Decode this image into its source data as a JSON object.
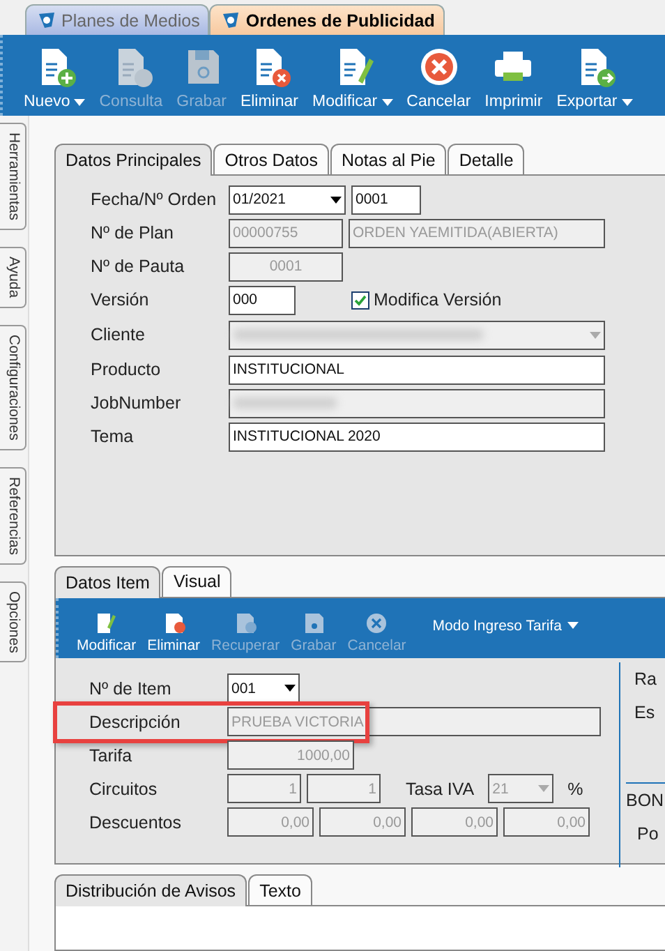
{
  "document_tabs": [
    {
      "label": "Planes de Medios",
      "selected": false
    },
    {
      "label": "Ordenes de Publicidad",
      "selected": true
    }
  ],
  "toolbar": [
    {
      "label": "Nuevo",
      "dropdown": true,
      "disabled": false
    },
    {
      "label": "Consulta",
      "dropdown": false,
      "disabled": true
    },
    {
      "label": "Grabar",
      "dropdown": false,
      "disabled": true
    },
    {
      "label": "Eliminar",
      "dropdown": false,
      "disabled": false
    },
    {
      "label": "Modificar",
      "dropdown": true,
      "disabled": false
    },
    {
      "label": "Cancelar",
      "dropdown": false,
      "disabled": false
    },
    {
      "label": "Imprimir",
      "dropdown": false,
      "disabled": false
    },
    {
      "label": "Exportar",
      "dropdown": true,
      "disabled": false
    }
  ],
  "side_tabs": [
    "Herramientas",
    "Ayuda",
    "Configuraciones",
    "Referencias",
    "Opciones"
  ],
  "main_tabs": [
    {
      "label": "Datos Principales",
      "selected": true
    },
    {
      "label": "Otros Datos",
      "selected": false
    },
    {
      "label": "Notas al Pie",
      "selected": false
    },
    {
      "label": "Detalle",
      "selected": false
    }
  ],
  "main_form": {
    "fecha_orden": {
      "label": "Fecha/Nº Orden",
      "period": {
        "value": "01/2021",
        "disabled": false
      },
      "number": {
        "value": "0001",
        "disabled": false
      }
    },
    "plan": {
      "label": "Nº de Plan",
      "number": {
        "value": "00000755",
        "disabled": true
      },
      "status": {
        "value": "ORDEN YAEMITIDA(ABIERTA)",
        "disabled": true
      }
    },
    "pauta": {
      "label": "Nº de Pauta",
      "value": "0001",
      "disabled": true
    },
    "version": {
      "label": "Versión",
      "value": "000",
      "disabled": false,
      "checkbox": {
        "label": "Modifica Versión",
        "checked": true
      }
    },
    "cliente": {
      "label": "Cliente",
      "disabled": true,
      "blurred": true
    },
    "producto": {
      "label": "Producto",
      "value": "INSTITUCIONAL",
      "disabled": false
    },
    "job_number": {
      "label": "JobNumber",
      "blurred": true
    },
    "tema": {
      "label": "Tema",
      "value": "INSTITUCIONAL 2020",
      "disabled": false
    }
  },
  "item_tabs": [
    {
      "label": "Datos Item",
      "selected": true
    },
    {
      "label": "Visual",
      "selected": false
    }
  ],
  "item_toolbar": {
    "buttons": [
      {
        "label": "Modificar",
        "disabled": false
      },
      {
        "label": "Eliminar",
        "disabled": false
      },
      {
        "label": "Recuperar",
        "disabled": true
      },
      {
        "label": "Grabar",
        "disabled": true
      },
      {
        "label": "Cancelar",
        "disabled": true
      }
    ],
    "mode_menu": "Modo Ingreso Tarifa"
  },
  "item_form": {
    "item": {
      "label": "Nº de Item",
      "value": "001",
      "disabled": false
    },
    "descripcion": {
      "label": "Descripción",
      "value": "PRUEBA VICTORIA",
      "disabled": true,
      "highlighted": true
    },
    "tarifa": {
      "label": "Tarifa",
      "value": "1000,00",
      "disabled": true
    },
    "circuitos": {
      "label": "Circuitos",
      "values": [
        "1",
        "1"
      ]
    },
    "tasa_iva": {
      "label": "Tasa IVA",
      "value": "21",
      "unit": "%",
      "disabled": true
    },
    "descuentos": {
      "label": "Descuentos",
      "values": [
        "0,00",
        "0,00",
        "0,00",
        "0,00"
      ]
    }
  },
  "right_column": {
    "labels": [
      "Ra",
      "Es"
    ],
    "section": "BON",
    "section_labels": [
      "Po"
    ]
  },
  "bottom_tabs": [
    {
      "label": "Distribución de Avisos",
      "selected": true
    },
    {
      "label": "Texto",
      "selected": false
    }
  ]
}
